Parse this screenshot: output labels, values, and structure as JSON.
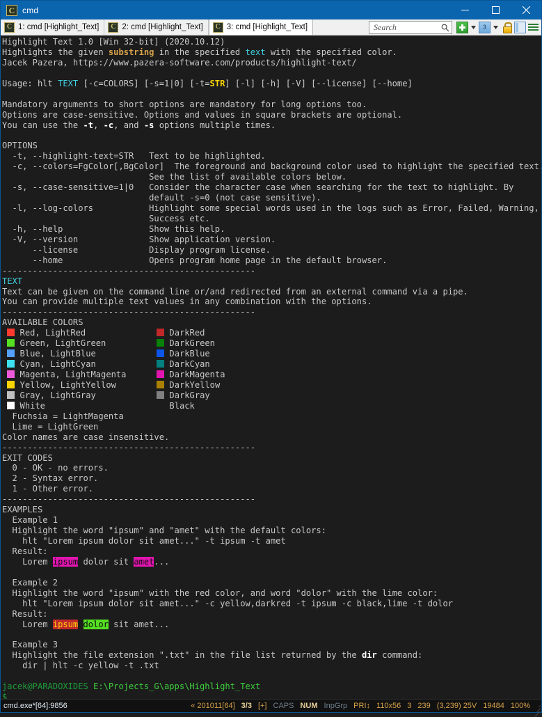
{
  "window": {
    "title": "cmd",
    "icon": "console-app-icon",
    "minimize_label": "–",
    "maximize_label": "□",
    "close_label": "×"
  },
  "tabs": [
    {
      "label": "1: cmd [Highlight_Text]",
      "active": false
    },
    {
      "label": "2: cmd [Highlight_Text]",
      "active": false
    },
    {
      "label": "3: cmd [Highlight_Text]",
      "active": true
    }
  ],
  "toolbar": {
    "search_placeholder": "Search",
    "search_value": "",
    "new_console_label": "+",
    "new_console_caret": "▾",
    "active_console_number": "3",
    "console_list_caret": "▾",
    "lock_label": "lock",
    "panel_label": "panel",
    "menu_label": "menu"
  },
  "console": {
    "header": {
      "product": "Highlight Text 1.0 [Win 32-bit] (2020.10.12)",
      "desc_pre": "Highlights the given ",
      "desc_substring": "substring",
      "desc_mid": " in the specified ",
      "desc_text": "text",
      "desc_post": " with the specified color.",
      "author": "Jacek Pazera, https://www.pazera-software.com/products/highlight-text/"
    },
    "usage": {
      "prefix": "Usage: hlt ",
      "text_token": "TEXT",
      "mid": " [-c=COLORS] [-s=1|0] [-t=",
      "str_token": "STR",
      "suffix": "] [-l] [-h] [-V] [--license] [--home]"
    },
    "notes": [
      "Mandatory arguments to short options are mandatory for long options too.",
      "Options are case-sensitive. Options and values in square brackets are optional."
    ],
    "note_multi": {
      "pre": "You can use the ",
      "t": "-t",
      "sep1": ", ",
      "c": "-c",
      "sep2": ", and ",
      "s": "-s",
      "post": " options multiple times."
    },
    "options_heading": "OPTIONS",
    "options": [
      {
        "flag": "  -t, --highlight-text=STR",
        "desc": "Text to be highlighted."
      },
      {
        "flag": "  -c, --colors=FgColor[,BgColor]",
        "desc": "The foreground and background color used to highlight the specified text."
      },
      {
        "flag": "",
        "desc": "See the list of available colors below."
      },
      {
        "flag": "  -s, --case-sensitive=1|0",
        "desc": "Consider the character case when searching for the text to highlight. By"
      },
      {
        "flag": "",
        "desc": "default -s=0 (not case sensitive)."
      },
      {
        "flag": "  -l, --log-colors",
        "desc": "Highlight some special words used in the logs such as Error, Failed, Warning,"
      },
      {
        "flag": "",
        "desc": "Success etc."
      },
      {
        "flag": "  -h, --help",
        "desc": "Show this help."
      },
      {
        "flag": "  -V, --version",
        "desc": "Show application version."
      },
      {
        "flag": "      --license",
        "desc": "Display program license."
      },
      {
        "flag": "      --home",
        "desc": "Opens program home page in the default browser."
      }
    ],
    "separator": "--------------------------------------------------",
    "text_section": {
      "heading": "TEXT",
      "lines": [
        "Text can be given on the command line or/and redirected from an external command via a pipe.",
        "You can provide multiple text values in any combination with the options."
      ]
    },
    "colors_section": {
      "heading": "AVAILABLE COLORS",
      "rows": [
        {
          "left_swatch": "#ff3b30",
          "left_label": "Red, LightRed",
          "right_swatch": "#c0282a",
          "right_label": "DarkRed"
        },
        {
          "left_swatch": "#55e022",
          "left_label": "Green, LightGreen",
          "right_swatch": "#068006",
          "right_label": "DarkGreen"
        },
        {
          "left_swatch": "#55a0fa",
          "left_label": "Blue, LightBlue",
          "right_swatch": "#0b56e8",
          "right_label": "DarkBlue"
        },
        {
          "left_swatch": "#3de1ef",
          "left_label": "Cyan, LightCyan",
          "right_swatch": "#038080",
          "right_label": "DarkCyan"
        },
        {
          "left_swatch": "#ee5ad9",
          "left_label": "Magenta, LightMagenta",
          "right_swatch": "#e215b0",
          "right_label": "DarkMagenta"
        },
        {
          "left_swatch": "#fad503",
          "left_label": "Yellow, LightYellow",
          "right_swatch": "#aa8000",
          "right_label": "DarkYellow"
        },
        {
          "left_swatch": "#c0c0c0",
          "left_label": "Gray, LightGray",
          "right_swatch": "#808080",
          "right_label": "DarkGray"
        },
        {
          "left_swatch": "#ffffff",
          "left_label": "White",
          "right_swatch": "",
          "right_label": "Black"
        }
      ],
      "aliases": [
        "  Fuchsia = LightMagenta",
        "  Lime = LightGreen"
      ],
      "footer": "Color names are case insensitive."
    },
    "exit_codes": {
      "heading": "EXIT CODES",
      "items": [
        "  0 - OK - no errors.",
        "  2 - Syntax error.",
        "  1 - Other error."
      ]
    },
    "examples": {
      "heading": "EXAMPLES",
      "items": [
        {
          "title": "  Example 1",
          "desc": "  Highlight the word \"ipsum\" and \"amet\" with the default colors:",
          "command": "    hlt \"Lorem ipsum dolor sit amet...\" -t ipsum -t amet",
          "result_label": "  Result:",
          "result_prefix": "    Lorem ",
          "result_hl1": "ipsum",
          "result_mid": " dolor sit ",
          "result_hl2": "amet",
          "result_suffix": "..."
        },
        {
          "title": "  Example 2",
          "desc": "  Highlight the word \"ipsum\" with the red color, and word \"dolor\" with the lime color:",
          "command": "    hlt \"Lorem ipsum dolor sit amet...\" -c yellow,darkred -t ipsum -c black,lime -t dolor",
          "result_label": "  Result:",
          "result_prefix": "    Lorem ",
          "result_hl1": "ipsum",
          "result_mid": " ",
          "result_hl2": "dolor",
          "result_suffix": " sit amet..."
        },
        {
          "title": "  Example 3",
          "desc_pre": "  Highlight the file extension \".txt\" in the file list returned by the ",
          "desc_cmd": "dir",
          "desc_post": " command:",
          "command": "    dir | hlt -c yellow -t .txt"
        }
      ]
    },
    "prompt": {
      "user_host": "jacek@PARADOXIDES",
      "path": "E:\\Projects_G\\apps\\Highlight_Text",
      "symbol": "$"
    }
  },
  "statusbar": {
    "process": "cmd.exe*[64]:9856",
    "build": "« 201011[64]",
    "tab_index": "3/3",
    "plus": "[+]",
    "caps": "CAPS",
    "num": "NUM",
    "inpgrp": "InpGrp",
    "pri": "PRI↕",
    "size": "110x56",
    "col": "3",
    "rows": "239",
    "cursor": "(3,239) 25V",
    "buffer": "19484",
    "zoom": "100%"
  }
}
